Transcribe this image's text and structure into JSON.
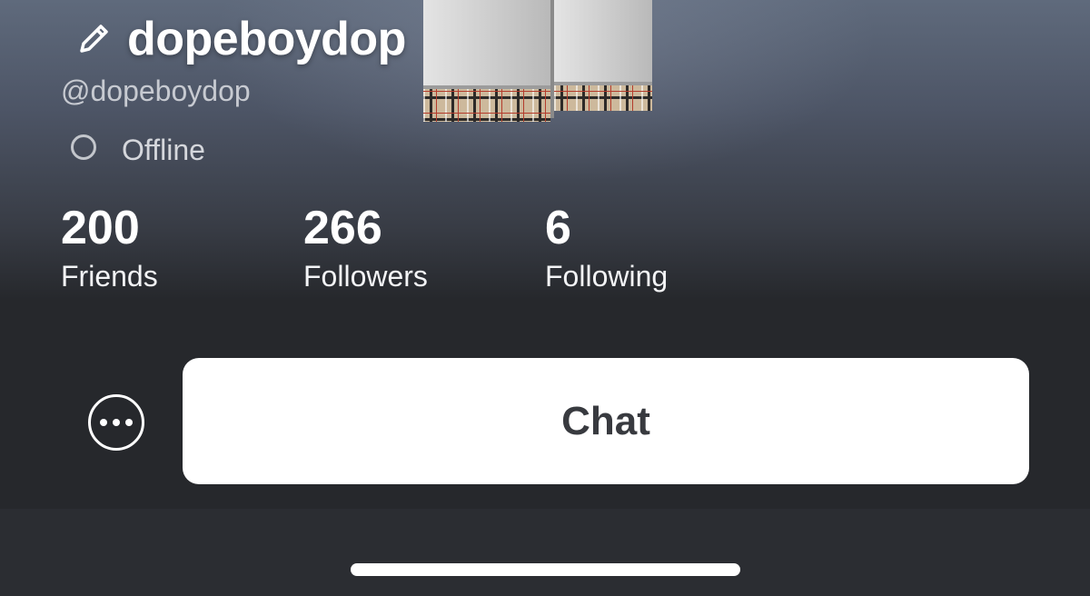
{
  "profile": {
    "display_name": "dopeboydop",
    "handle": "@dopeboydop",
    "status": "Offline"
  },
  "stats": [
    {
      "value": "200",
      "label": "Friends"
    },
    {
      "value": "266",
      "label": "Followers"
    },
    {
      "value": "6",
      "label": "Following"
    }
  ],
  "actions": {
    "chat_label": "Chat"
  },
  "icons": {
    "edit": "pencil-icon",
    "more": "more-horizontal-icon",
    "status": "status-circle-icon"
  },
  "colors": {
    "hero_top": "#5f6a7c",
    "background": "#26282c",
    "chat_button_bg": "#ffffff",
    "chat_button_text": "#383a3f"
  }
}
